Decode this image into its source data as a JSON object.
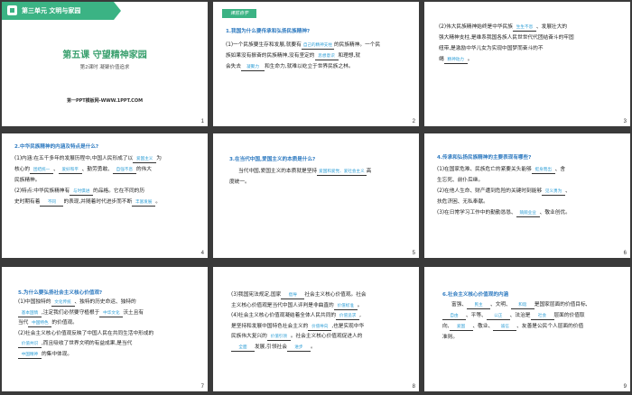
{
  "slide1": {
    "header": "第三单元   文明与家园",
    "title": "第五课 守望精神家园",
    "subtitle": "第2课时   凝聚价值追求",
    "footer": "第一PPT模板网-WWW.1PPT.COM",
    "num": "1"
  },
  "slide2": {
    "tag": "课前自学",
    "question": "1.我国为什么要传承和弘扬民族精神?",
    "p1a": "(1)一个民族要生存和发展,就要有",
    "a1": "自己的精神支柱",
    "p1b": "的民族精神。一个民",
    "p2a": "族如果没有振奋的民族精神,没有坚定的",
    "a2": "思想意识",
    "p2b": "和理想,就",
    "p3a": "会失去",
    "a3": "凝聚力",
    "p3b": "和生命力,就难以屹立于世界民族之林。",
    "num": "2"
  },
  "slide3": {
    "p1a": "(2)伟大民族精神始终是中华民族",
    "a1": "生生不息",
    "p1b": "、发展壮大的",
    "p2": "强大精神支柱,是维系我国各族人民世世代代团结奋斗的牢固",
    "p3a": "纽带,是激励中华儿女为实现中国梦而奋斗的不",
    "p4a": "竭",
    "a2": "精神动力",
    "p4b": "。",
    "num": "3"
  },
  "slide4": {
    "question": "2.中华民族精神的内涵及特点是什么?",
    "p1a": "(1)内涵:在五千多年的发展历程中,中国人民形成了以",
    "a1": "爱国主义",
    "p1b": "为",
    "p2a": "核心的",
    "a2": "团结统一",
    "p2b": "、",
    "a3": "爱好和平",
    "p2c": "、勤劳勇敢、",
    "a4": "自强不息",
    "p2d": "的伟大",
    "p3": "民族精神。",
    "p4a": "(2)特点:中华民族精神有",
    "a5": "与时俱进",
    "p4b": "的品格。它在不同的历",
    "p5a": "史时期有着",
    "a6": "不同",
    "p5b": "的表现,并随着时代进步而不断",
    "a7": "丰富发展",
    "p5c": "。",
    "num": "4"
  },
  "slide5": {
    "question": "3.在当代中国,爱国主义的本质是什么?",
    "p1a": "当代中国,爱国主义的本质就是坚持",
    "a1": "爱国和爱党、爱社会主义",
    "p1b": "高",
    "p2": "度统一。",
    "num": "5"
  },
  "slide6": {
    "question": "4.传承和弘扬民族精神的主要表现有哪些?",
    "p1a": "(1)在国家危难、民族危亡的紧要关头能够",
    "a1": "挺身而出",
    "p1b": "、舍",
    "p2": "生忘死、前仆后继。",
    "p3a": "(2)在他人生命、财产遭到危险的关键时刻能够",
    "a2": "见义勇为",
    "p3b": "、",
    "p4": "扶危济困、无私奉献。",
    "p5a": "(3)在日常学习工作中的勤勤恳恳、",
    "a3": "兢兢业业",
    "p5b": "、敬业创优。",
    "num": "6"
  },
  "slide7": {
    "question": "5.为什么要弘扬社会主义核心价值观?",
    "p1a": "(1)中国独特的",
    "a1": "文化传统",
    "p1b": "、独特的历史命运、独特的",
    "p2a": "",
    "a2": "基本国情",
    "p2b": ",注定我们必然要守植根于",
    "a3": "中华文化",
    "p2c": "沃土且有",
    "p3a": "当代",
    "a4": "中国特色",
    "p3b": "的价值观。",
    "p4": "(2)社会主义核心价值观反映了中国人民在共同生活中形成的",
    "p5a": "",
    "a5": "价值共识",
    "p5b": ",而且吸收了世界文明的有益成果,是当代",
    "p6a": "",
    "a6": "中国精神",
    "p6b": "的集中体现。",
    "num": "7"
  },
  "slide8": {
    "p1a": "(3)我国宪法规定,国家",
    "a1": "倡导",
    "p1b": "社会主义核心价值观。社会",
    "p2": "主义核心价值观是当代中国人评判是非曲直的",
    "a2": "价值标准",
    "p2b": "。",
    "p3a": "(4)社会主义核心价值观凝结着全体人民共同的",
    "a3": "价值追求",
    "p3b": ",",
    "p4a": "是坚持和发展中国特色社会主义的",
    "a4": "价值导向",
    "p4b": ",也是实现中华",
    "p5a": "民族伟大复兴的",
    "a5": "价值引领",
    "p5b": "。社会主义核心价值观促进人的",
    "p6a": "",
    "a6": "全面",
    "p6b": "发展,引领社会",
    "a7": "进步",
    "p6c": "。",
    "num": "8"
  },
  "slide9": {
    "question": "6.社会主义核心价值观的内涵",
    "p1a": "富强、",
    "a1": "民主",
    "p1b": "、文明、",
    "a2": "和谐",
    "p1c": "是国家层面的价值目标,",
    "a3": "自由",
    "p2b": "、平等、",
    "a4": "公正",
    "p2c": "、法治是",
    "a5": "社会",
    "p2d": "层面的价值取",
    "p3a": "向,",
    "a6": "爱国",
    "p3b": "、敬业、",
    "a7": "诚信",
    "p3c": "、友善是公民个人层面的价值",
    "p4": "准则。",
    "num": "9"
  }
}
